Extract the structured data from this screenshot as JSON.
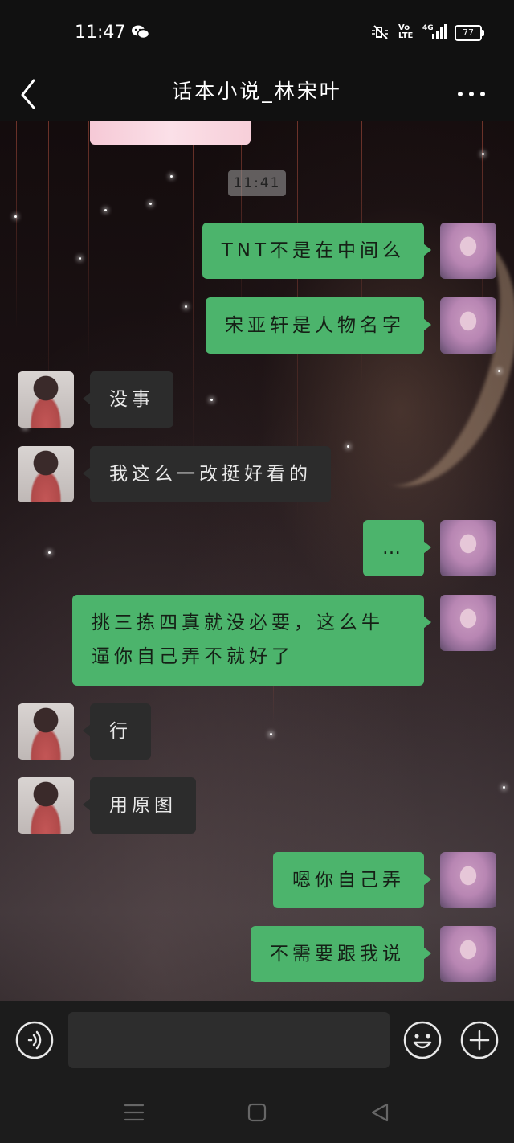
{
  "status_bar": {
    "time": "11:47",
    "volte_label": "Vo\nLTE",
    "network_label": "4G",
    "battery_level": "77"
  },
  "header": {
    "title": "话本小说_林宋叶"
  },
  "chat": {
    "timestamp": "11:41",
    "messages": [
      {
        "side": "me",
        "text": "TNT不是在中间么"
      },
      {
        "side": "me",
        "text": "宋亚轩是人物名字"
      },
      {
        "side": "her",
        "text": "没事"
      },
      {
        "side": "her",
        "text": "我这么一改挺好看的"
      },
      {
        "side": "me",
        "text": "…"
      },
      {
        "side": "me",
        "text": "挑三拣四真就没必要，这么牛逼你自己弄不就好了"
      },
      {
        "side": "her",
        "text": "行"
      },
      {
        "side": "her",
        "text": "用原图"
      },
      {
        "side": "me",
        "text": "嗯你自己弄"
      },
      {
        "side": "me",
        "text": "不需要跟我说"
      }
    ]
  },
  "input_bar": {
    "placeholder": ""
  },
  "icons": {
    "back": "chevron-left-icon",
    "more": "more-dots-icon",
    "voice": "voice-icon",
    "emoji": "emoji-icon",
    "plus": "plus-icon",
    "wechat": "wechat-icon"
  },
  "colors": {
    "my_bubble": "#4cb46c",
    "her_bubble": "#2c2c2c",
    "bar_bg": "#111111"
  }
}
